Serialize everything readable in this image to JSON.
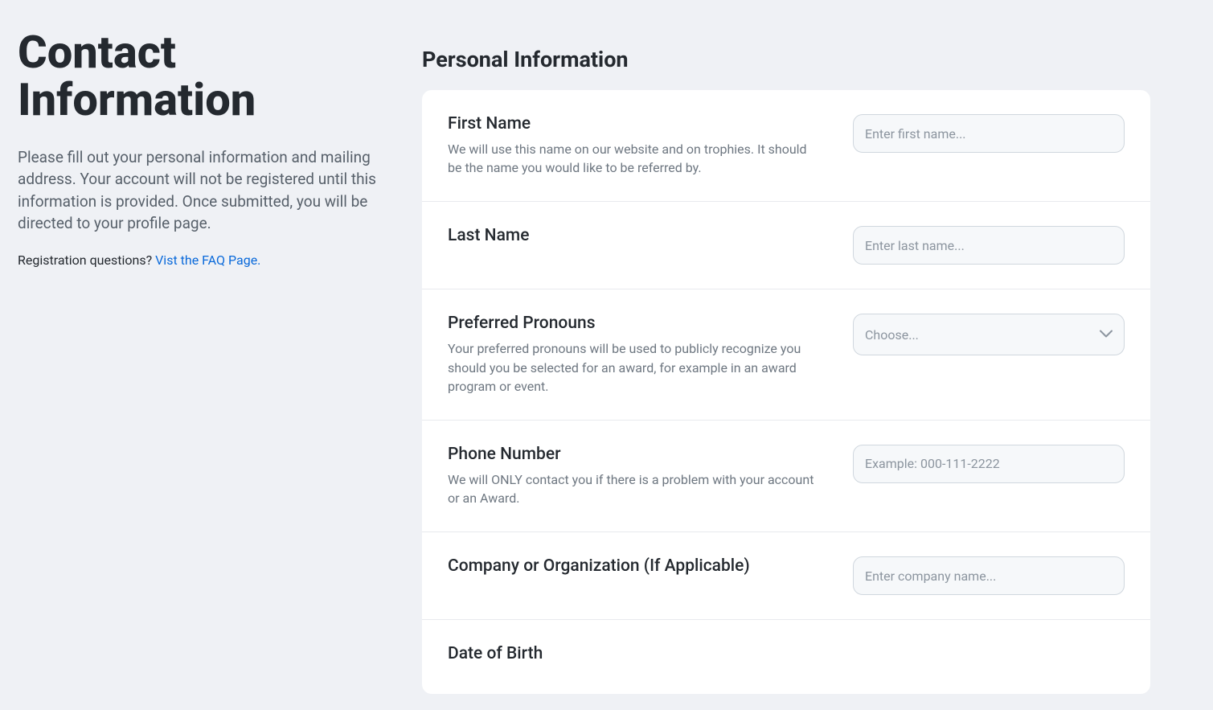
{
  "sidebar": {
    "title": "Contact Information",
    "description": "Please fill out your personal information and mailing address. Your account will not be registered until this information is provided. Once submitted, you will be directed to your profile page.",
    "faq_prefix": "Registration questions? ",
    "faq_link_text": "Vist the FAQ Page."
  },
  "main": {
    "section_heading": "Personal Information",
    "fields": {
      "first_name": {
        "label": "First Name",
        "help": "We will use this name on our website and on trophies. It should be the name you would like to be referred by.",
        "placeholder": "Enter first name..."
      },
      "last_name": {
        "label": "Last Name",
        "placeholder": "Enter last name..."
      },
      "pronouns": {
        "label": "Preferred Pronouns",
        "help": "Your preferred pronouns will be used to publicly recognize you should you be selected for an award, for example in an award program or event.",
        "placeholder": "Choose..."
      },
      "phone": {
        "label": "Phone Number",
        "help": "We will ONLY contact you if there is a problem with your account or an Award.",
        "placeholder": "Example: 000-111-2222"
      },
      "company": {
        "label": "Company or Organization (If Applicable)",
        "placeholder": "Enter company name..."
      },
      "dob": {
        "label": "Date of Birth"
      }
    }
  }
}
